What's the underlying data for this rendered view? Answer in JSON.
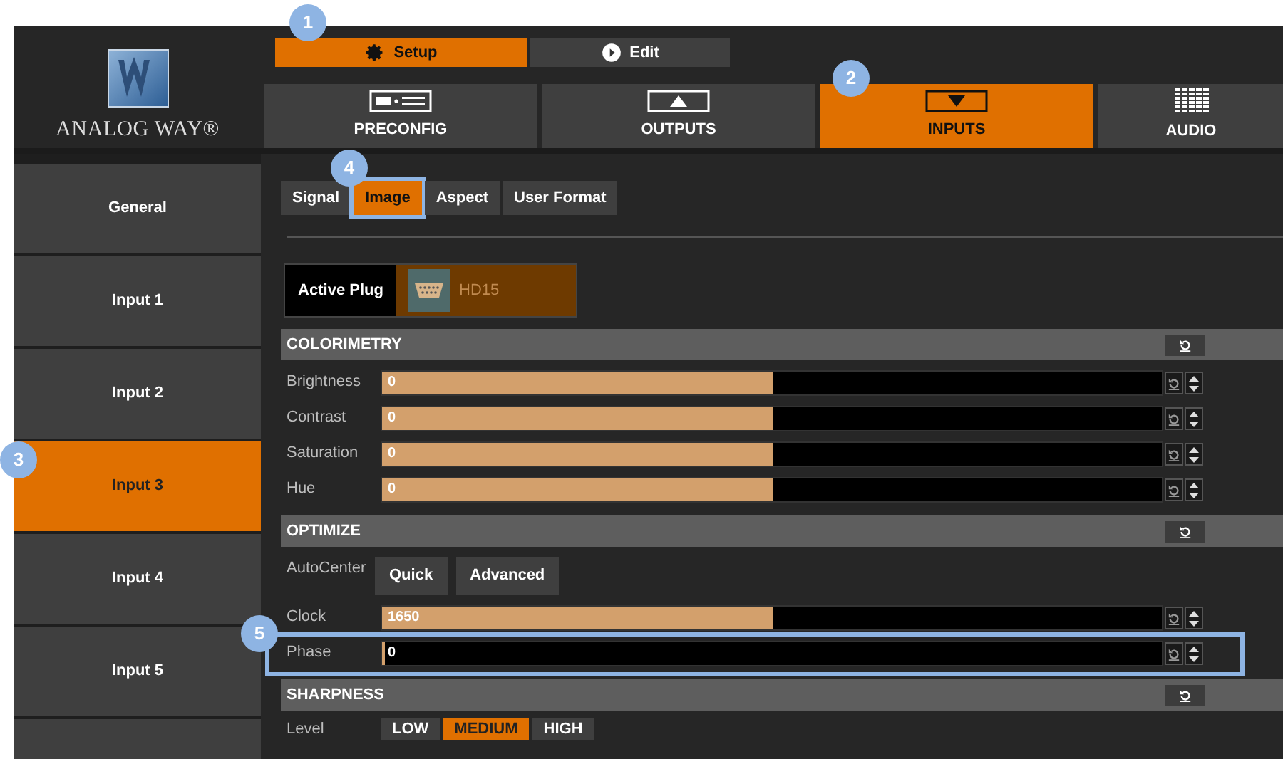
{
  "logo": {
    "text": "ANALOG WAY®"
  },
  "mode_tabs": [
    {
      "label": "Setup",
      "selected": true,
      "callout": "1"
    },
    {
      "label": "Edit",
      "selected": false
    }
  ],
  "main_tabs": [
    {
      "label": "PRECONFIG",
      "selected": false
    },
    {
      "label": "OUTPUTS",
      "selected": false
    },
    {
      "label": "INPUTS",
      "selected": true,
      "callout": "2"
    },
    {
      "label": "AUDIO",
      "selected": false
    }
  ],
  "sidebar": {
    "items": [
      {
        "label": "General",
        "selected": false
      },
      {
        "label": "Input 1",
        "selected": false
      },
      {
        "label": "Input 2",
        "selected": false
      },
      {
        "label": "Input 3",
        "selected": true,
        "callout": "3"
      },
      {
        "label": "Input 4",
        "selected": false
      },
      {
        "label": "Input 5",
        "selected": false
      }
    ]
  },
  "sub_tabs": [
    {
      "label": "Signal",
      "selected": false
    },
    {
      "label": "Image",
      "selected": true,
      "callout": "4"
    },
    {
      "label": "Aspect",
      "selected": false
    },
    {
      "label": "User Format",
      "selected": false
    }
  ],
  "active_plug": {
    "label": "Active Plug",
    "value": "HD15"
  },
  "sections": [
    {
      "title": "COLORIMETRY",
      "rows": [
        {
          "kind": "slider",
          "label": "Brightness",
          "value": "0",
          "level": 0.5
        },
        {
          "kind": "slider",
          "label": "Contrast",
          "value": "0",
          "level": 0.5
        },
        {
          "kind": "slider",
          "label": "Saturation",
          "value": "0",
          "level": 0.5
        },
        {
          "kind": "slider",
          "label": "Hue",
          "value": "0",
          "level": 0.5
        }
      ]
    },
    {
      "title": "OPTIMIZE",
      "rows": [
        {
          "kind": "buttons",
          "label": "AutoCenter",
          "buttons": [
            "Quick",
            "Advanced"
          ]
        },
        {
          "kind": "slider",
          "label": "Clock",
          "value": "1650",
          "level": 0.5
        },
        {
          "kind": "slider",
          "label": "Phase",
          "value": "0",
          "level": 0,
          "callout": "5"
        }
      ]
    },
    {
      "title": "SHARPNESS",
      "rows": [
        {
          "kind": "choice",
          "label": "Level",
          "options": [
            {
              "label": "LOW",
              "selected": false
            },
            {
              "label": "MEDIUM",
              "selected": true
            },
            {
              "label": "HIGH",
              "selected": false
            }
          ]
        }
      ]
    }
  ]
}
